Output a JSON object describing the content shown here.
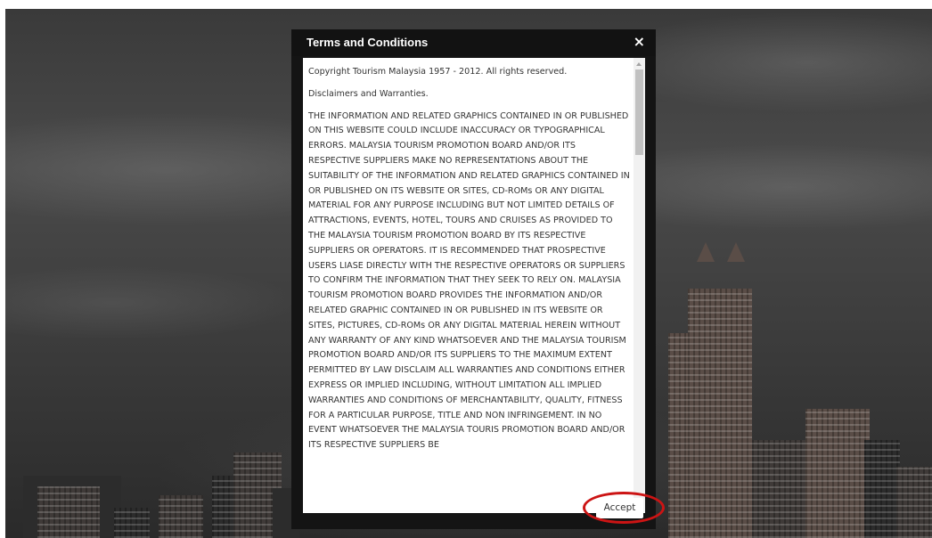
{
  "modal": {
    "title": "Terms and Conditions",
    "close_label": "×",
    "paragraphs": [
      "Copyright Tourism Malaysia 1957 - 2012. All rights reserved.",
      "Disclaimers and Warranties.",
      "THE INFORMATION AND RELATED GRAPHICS CONTAINED IN OR PUBLISHED ON THIS WEBSITE COULD INCLUDE INACCURACY OR TYPOGRAPHICAL ERRORS. MALAYSIA TOURISM PROMOTION BOARD AND/OR ITS RESPECTIVE SUPPLIERS MAKE NO REPRESENTATIONS ABOUT THE SUITABILITY OF THE INFORMATION AND RELATED GRAPHICS CONTAINED IN OR PUBLISHED ON ITS WEBSITE OR SITES, CD-ROMs OR ANY DIGITAL MATERIAL FOR ANY PURPOSE INCLUDING BUT NOT LIMITED DETAILS OF ATTRACTIONS, EVENTS, HOTEL, TOURS AND CRUISES AS PROVIDED TO THE MALAYSIA TOURISM PROMOTION BOARD BY ITS RESPECTIVE SUPPLIERS OR OPERATORS. IT IS RECOMMENDED THAT PROSPECTIVE USERS LIASE DIRECTLY WITH THE RESPECTIVE OPERATORS OR SUPPLIERS TO CONFIRM THE INFORMATION THAT THEY SEEK TO RELY ON. MALAYSIA TOURISM PROMOTION BOARD PROVIDES THE INFORMATION AND/OR RELATED GRAPHIC CONTAINED IN OR PUBLISHED IN ITS WEBSITE OR SITES, PICTURES, CD-ROMs OR ANY DIGITAL MATERIAL HEREIN WITHOUT ANY WARRANTY OF ANY KIND WHATSOEVER AND THE MALAYSIA TOURISM PROMOTION BOARD AND/OR ITS SUPPLIERS TO THE MAXIMUM EXTENT PERMITTED BY LAW DISCLAIM ALL WARRANTIES AND CONDITIONS EITHER EXPRESS OR IMPLIED INCLUDING, WITHOUT LIMITATION ALL IMPLIED WARRANTIES AND CONDITIONS OF MERCHANTABILITY, QUALITY, FITNESS FOR A PARTICULAR PURPOSE, TITLE AND NON INFRINGEMENT. IN NO EVENT WHATSOEVER THE MALAYSIA TOURIS PROMOTION BOARD AND/OR ITS RESPECTIVE SUPPLIERS BE"
    ],
    "accept_label": "Accept"
  },
  "colors": {
    "header_bg": "#121212",
    "body_bg": "#ffffff",
    "text": "#333333",
    "highlight_ring": "#cc1414"
  },
  "icons": {
    "close": "close-icon"
  }
}
